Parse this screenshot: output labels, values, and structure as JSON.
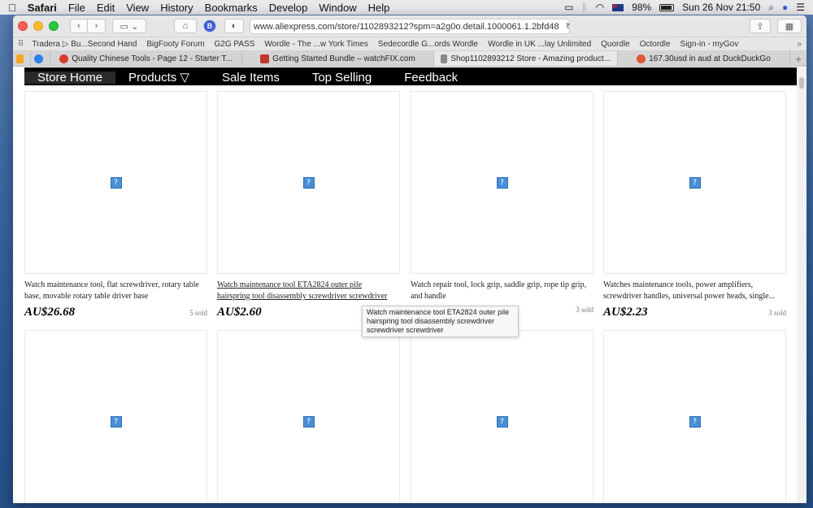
{
  "menubar": {
    "app": "Safari",
    "items": [
      "File",
      "Edit",
      "View",
      "History",
      "Bookmarks",
      "Develop",
      "Window",
      "Help"
    ],
    "battery": "98%",
    "datetime": "Sun 26 Nov  21:50"
  },
  "toolbar": {
    "url": "www.aliexpress.com/store/1102893212?spm=a2g0o.detail.1000061.1.2bfd48"
  },
  "bookmarks": [
    "Tradera ▷ Bu...Second Hand",
    "BigFooty Forum",
    "G2G PASS",
    "Wordle - The ...w York Times",
    "Sedecordle G...ords Wordle",
    "Wordle in UK ...lay Unlimited",
    "Quordle",
    "Octordle",
    "Sign-in - myGov"
  ],
  "tabs": [
    {
      "label": "Quality Chinese Tools - Page 12 - Starter T...",
      "color": "#d93a2b"
    },
    {
      "label": "Getting Started Bundle – watchFIX.com",
      "color": "#c0392b"
    },
    {
      "label": "Shop1102893212 Store - Amazing product...",
      "color": "#888888"
    },
    {
      "label": "167.30usd in aud at DuckDuckGo",
      "color": "#de5833"
    }
  ],
  "storenav": {
    "items": [
      "Store Home",
      "Products ▽",
      "Sale Items",
      "Top Selling",
      "Feedback"
    ]
  },
  "products": [
    {
      "title": "Watch maintenance tool, flat screwdriver, rotary table base, movable rotary table driver base",
      "price": "AU$26.68",
      "sold": "5 sold"
    },
    {
      "title": "Watch maintenance tool ETA2824 outer pile hairspring tool disassembly screwdriver screwdriver screwdriver",
      "price": "AU$2.60",
      "sold": ""
    },
    {
      "title": "Watch repair tool, lock grip, saddle grip, rope tip grip, and handle",
      "price": "",
      "sold": "3 sold"
    },
    {
      "title": "Watches maintenance tools, power amplifiers, screwdriver handles, universal power heads, single...",
      "price": "AU$2.23",
      "sold": "3 sold"
    }
  ],
  "tooltip": "Watch maintenance tool ETA2824 outer pile hairspring tool disassembly screwdriver screwdriver screwdriver"
}
